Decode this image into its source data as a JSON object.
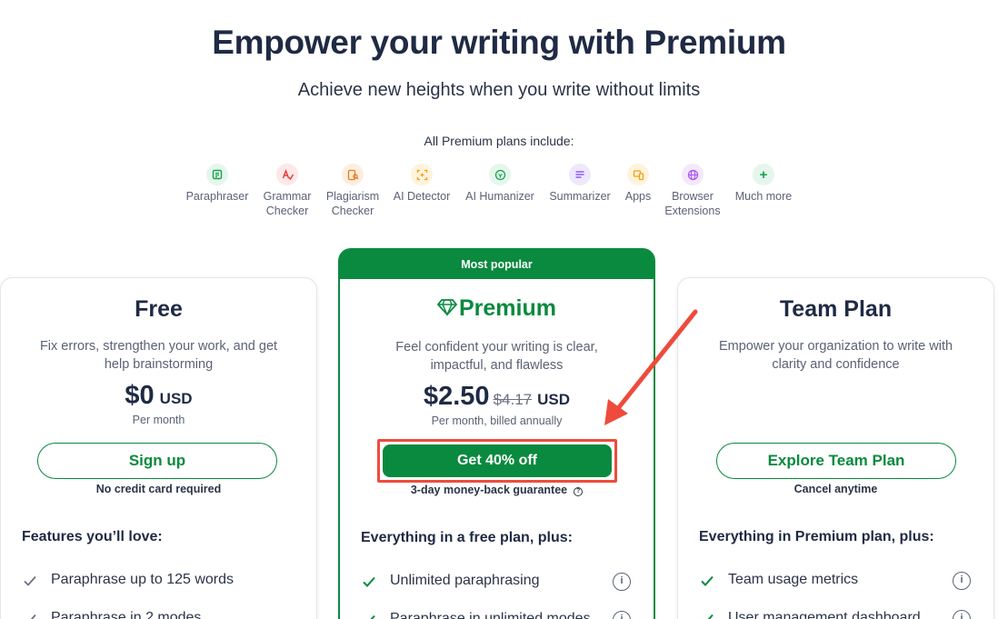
{
  "hero": {
    "title": "Empower your writing with Premium",
    "subtitle": "Achieve new heights when you write without limits",
    "includes_label": "All Premium plans include:"
  },
  "features": [
    {
      "label": "Paraphraser",
      "icon": "paraphraser-icon",
      "color": "#16a34a",
      "bg": "#e6f6ec"
    },
    {
      "label": "Grammar Checker",
      "icon": "grammar-checker-icon",
      "color": "#e23b3b",
      "bg": "#fde8e8"
    },
    {
      "label": "Plagiarism Checker",
      "icon": "plagiarism-checker-icon",
      "color": "#ea7a1a",
      "bg": "#fdeee0"
    },
    {
      "label": "AI Detector",
      "icon": "ai-detector-icon",
      "color": "#f59e0b",
      "bg": "#fef3dc"
    },
    {
      "label": "AI Humanizer",
      "icon": "ai-humanizer-icon",
      "color": "#16a34a",
      "bg": "#e6f6ec"
    },
    {
      "label": "Summarizer",
      "icon": "summarizer-icon",
      "color": "#8b5cf6",
      "bg": "#efe8fd"
    },
    {
      "label": "Apps",
      "icon": "apps-icon",
      "color": "#f59e0b",
      "bg": "#fef3dc"
    },
    {
      "label": "Browser Extensions",
      "icon": "browser-extensions-icon",
      "color": "#a855f7",
      "bg": "#f4e8fd"
    },
    {
      "label": "Much more",
      "icon": "plus-icon",
      "color": "#16a34a",
      "bg": "#e6f6ec"
    }
  ],
  "plans": {
    "free": {
      "name": "Free",
      "description": "Fix errors, strengthen your work, and get help brainstorming",
      "price": "$0",
      "currency": "USD",
      "price_note": "Per month",
      "button": "Sign up",
      "button_note": "No credit card required",
      "features_heading": "Features you’ll love:",
      "features": [
        "Paraphrase up to 125 words",
        "Paraphrase in 2 modes"
      ]
    },
    "premium": {
      "badge": "Most popular",
      "name": "Premium",
      "description": "Feel confident your writing is clear, impactful, and flawless",
      "price": "$2.50",
      "old_price": "$4.17",
      "currency": "USD",
      "price_note": "Per month, billed annually",
      "button": "Get 40% off",
      "button_note": "3-day money-back guarantee",
      "features_heading": "Everything in a free plan, plus:",
      "features": [
        "Unlimited paraphrasing",
        "Paraphrase in unlimited modes"
      ]
    },
    "team": {
      "name": "Team Plan",
      "description": "Empower your organization to write with clarity and confidence",
      "button": "Explore Team Plan",
      "button_note": "Cancel anytime",
      "features_heading": "Everything in Premium plan, plus:",
      "features": [
        "Team usage metrics",
        "User management dashboard"
      ]
    }
  },
  "colors": {
    "brand": "#0a8a3e",
    "highlight": "#ee4b3c",
    "text": "#1f2a44"
  }
}
